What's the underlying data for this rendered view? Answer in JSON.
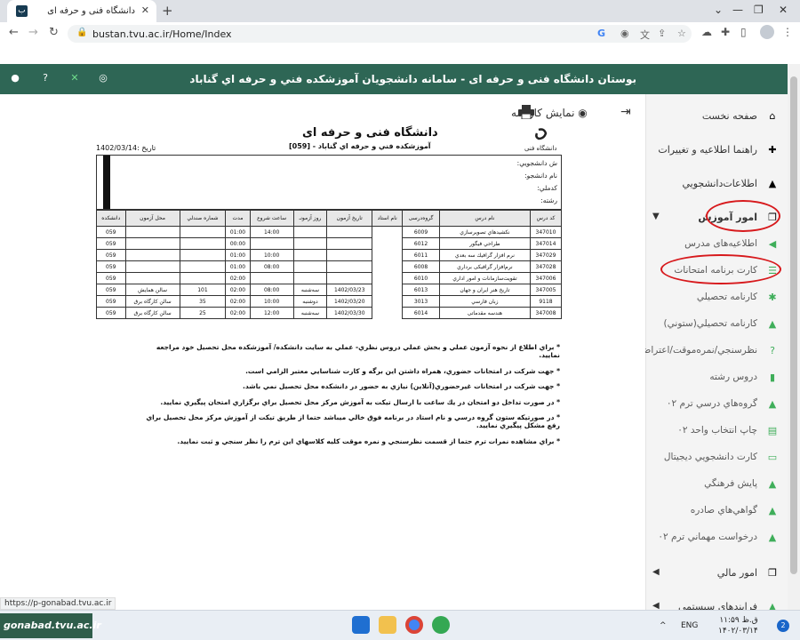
{
  "browser": {
    "tab_title": "دانشگاه فنی و حرفه ای",
    "tab_favicon": "ب",
    "url": "bustan.tvu.ac.ir/Home/Index"
  },
  "topbar": {
    "title": "بوستان دانشگاه فنی و حرفه ای - سامانه دانشجويان آموزشکده فني و حرفه اي گناباد"
  },
  "sidebar": {
    "items": [
      {
        "label": "صفحه نخست",
        "icon": "home-icon"
      },
      {
        "label": "راهنما اطلاعیه و تغییرات",
        "icon": "puzzle-icon"
      },
      {
        "label": "اطلاعات‌دانشجويي",
        "icon": "graduation-cap-icon"
      },
      {
        "label": "امور آموزش",
        "icon": "copy-icon"
      },
      {
        "label": "اطلاعیه‌های مدرس",
        "icon": "megaphone-icon"
      },
      {
        "label": "كارت برنامه امتحانات",
        "icon": "list-icon"
      },
      {
        "label": "كارنامه تحصيلي",
        "icon": "snowflake-icon"
      },
      {
        "label": "كارنامه تحصيلي(ستوني)",
        "icon": "bell-icon"
      },
      {
        "label": "نظرسنجي/نمره‌موقت/اعتراض",
        "icon": "question-icon"
      },
      {
        "label": "دروس رشته",
        "icon": "bookmark-icon"
      },
      {
        "label": "گروه‌هاي درسي ترم ۰۲",
        "icon": "bell-icon"
      },
      {
        "label": "چاپ انتخاب واحد ۰۲",
        "icon": "print-icon"
      },
      {
        "label": "كارت دانشجويي ديجيتال",
        "icon": "card-icon"
      },
      {
        "label": "پايش فرهنگي",
        "icon": "bell-icon"
      },
      {
        "label": "گواهي‌هاي صادره",
        "icon": "bell-icon"
      },
      {
        "label": "درخواست مهماني ترم ۰۲",
        "icon": "bell-icon"
      },
      {
        "label": "امور مالي",
        "icon": "copy-icon"
      },
      {
        "label": "فرايندهاي سيستمي",
        "icon": "bell-icon"
      }
    ]
  },
  "content": {
    "header_label": "نمایش کارنامه",
    "doc_title": "دانشگاه فنی و حرفه ای",
    "doc_subtitle": "آموزشکده فني و حرفه اي گناباد - [059]",
    "doc_date": "تاریخ :1402/03/14",
    "logo_text": "دانشگاه فنی",
    "info_labels": [
      "ش دانشجويي:",
      "نام دانشجو:",
      "كدملي:",
      "رشته:"
    ],
    "columns": [
      "كد درس",
      "نام درس",
      "گروه‌درسی",
      "نام استاد",
      "تاريخ آزمون",
      "روز آزمونـ",
      "ساعت شروع",
      "مدت",
      "شماره صندلي",
      "محل آزمون",
      "دانشكده"
    ],
    "rows": [
      [
        "347010",
        "نكشيدهاي تصويرسازي",
        "6009",
        "",
        "",
        "",
        "14:00",
        "01:00",
        "",
        "",
        "059"
      ],
      [
        "347014",
        "طراحي فيگور",
        "6012",
        "",
        "",
        "",
        "",
        "00:00",
        "",
        "",
        "059"
      ],
      [
        "347029",
        "نرم افزار گرافيك سه بعدي",
        "6011",
        "",
        "",
        "",
        "10:00",
        "01:00",
        "",
        "",
        "059"
      ],
      [
        "347028",
        "نرم‌افزار گرافیکی برداري",
        "6008",
        "",
        "",
        "",
        "08:00",
        "01:00",
        "",
        "",
        "059"
      ],
      [
        "347006",
        "تقويت‌سازمانات و امور اداري",
        "6010",
        "",
        "",
        "",
        "",
        "02:00",
        "",
        "",
        "059"
      ],
      [
        "347005",
        "تاريخ هنر ايران و جهان",
        "6013",
        "",
        "1402/03/23",
        "سه‌شنبه",
        "08:00",
        "02:00",
        "101",
        "سالن همايش",
        "059"
      ],
      [
        "9118",
        "زبان فارسي",
        "3013",
        "",
        "1402/03/20",
        "دوشنبه",
        "10:00",
        "02:00",
        "35",
        "سالن كارگاه برق",
        "059"
      ],
      [
        "347008",
        "هندسه مقدماتی",
        "6014",
        "",
        "1402/03/30",
        "سه‌شنبه",
        "12:00",
        "02:00",
        "25",
        "سالن كارگاه برق",
        "059"
      ]
    ],
    "notes": [
      "* براي اطلاع از نحوه آزمون عملي و بخش عملي دروس نظري- عملي به سايت دانشكده/ آموزشكده محل تحصيل خود مراجعه نماييد.",
      "* جهت شركت در امتحانات حضوري، همراه داشتن اين برگه و كارت شناسايي معتبر الزامي است.",
      "* جهت شركت در امتحانات غيرحضوري(آنلاين) نيازي به حضور در دانشكده محل تحصيل نمي باشد.",
      "* در صورت تداخل دو امتحان در يك ساعت با ارسال تيكت به آموزش مركز محل تحصيل براي برگزاري امتحان پيگيري نماييد.",
      "* در صورتيكه ستون گروه درسي و نام استاد در برنامه فوق خالي ميباشد حتما از طريق تيكت از آموزش مركز محل تحصيل براي رفع مشكل پيگيري نماييد.",
      "* براي مشاهده نمرات ترم حتما از قسمت نظرسنجي و نمره موقت كليه كلاسهاي اين ترم را نظر سنجي و ثبت نماييد."
    ]
  },
  "status_url": "https://p-gonabad.tvu.ac.ir",
  "watermark": "gonabad.tvu.ac.ir",
  "taskbar": {
    "lang": "ENG",
    "time": "۱۱:۵۹ ق.ظ",
    "date": "۱۴۰۲/۰۳/۱۴",
    "notif_count": "2"
  },
  "colors": {
    "topbar": "#2e6655",
    "accent_green": "#3fae5a",
    "highlight_red": "#d7191c"
  }
}
